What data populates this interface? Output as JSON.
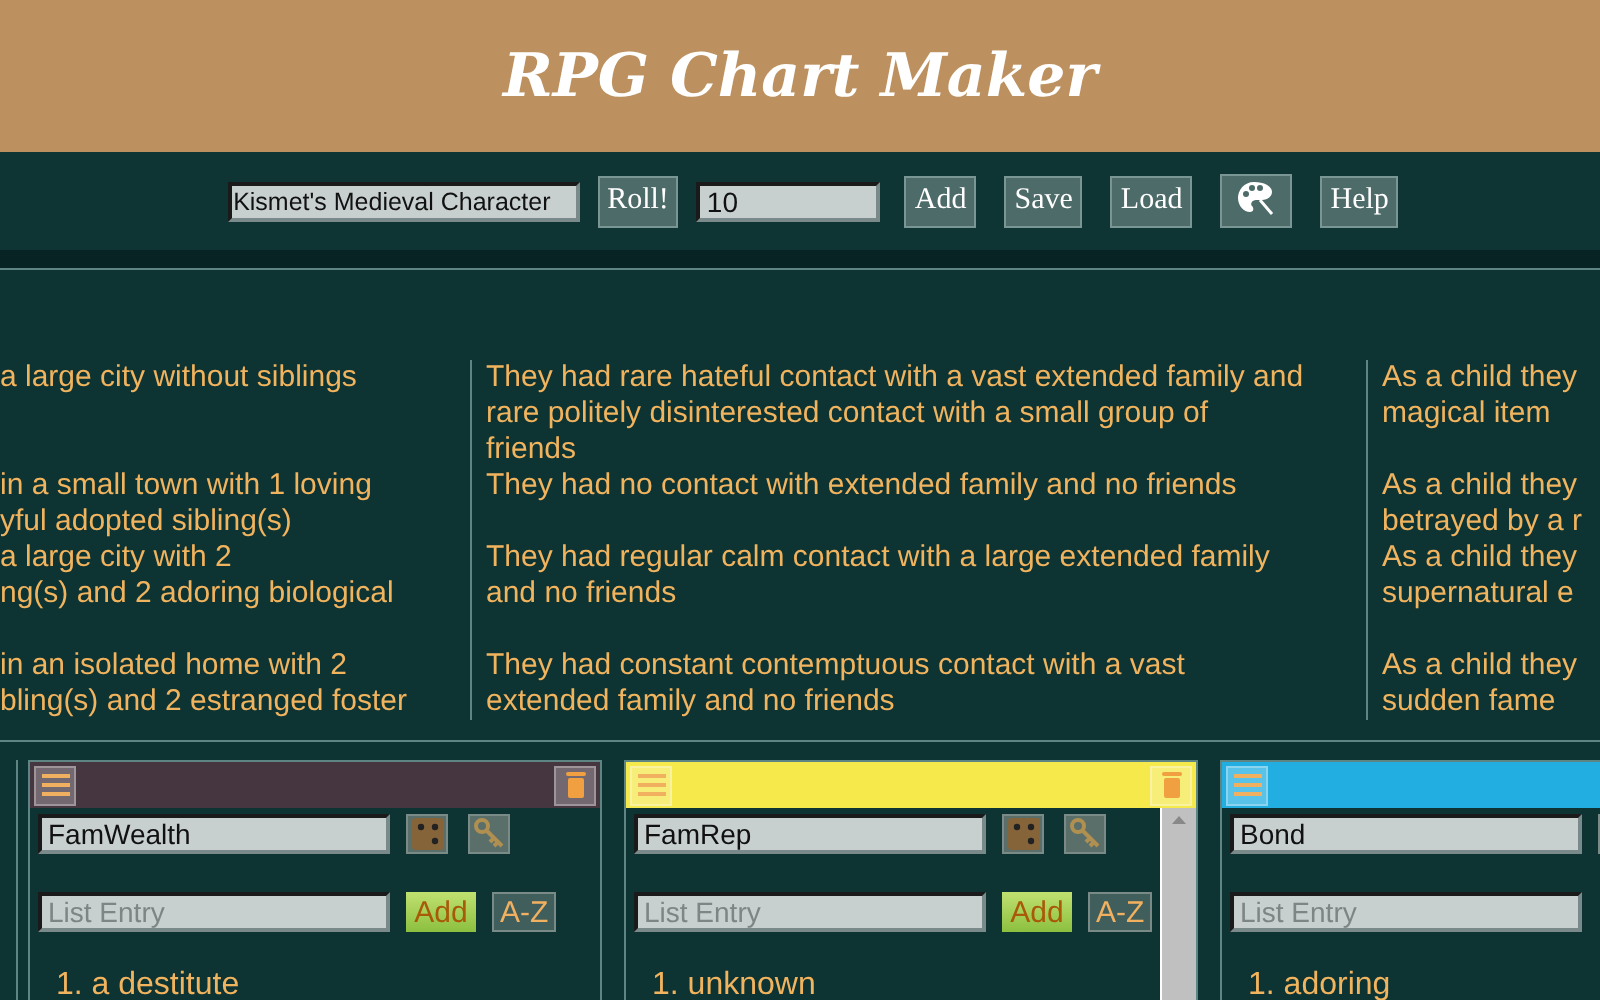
{
  "header": {
    "title": "RPG Chart Maker"
  },
  "toolbar": {
    "chart_name": "Kismet's Medieval Character",
    "roll_button": "Roll!",
    "roll_count": "10",
    "buttons": [
      {
        "kind": "text",
        "label": "Add"
      },
      {
        "kind": "text",
        "label": "Save"
      },
      {
        "kind": "text",
        "label": "Load"
      },
      {
        "kind": "palette"
      },
      {
        "kind": "text",
        "label": "Help"
      }
    ]
  },
  "results": {
    "columns": [
      {
        "cells": [
          [
            "a large city without siblings"
          ],
          [
            "in a small town with 1 loving",
            "yful adopted sibling(s)"
          ],
          [
            "a large city with 2",
            "ng(s) and 2 adoring biological"
          ],
          [
            "in an isolated home with 2",
            "bling(s) and 2 estranged foster"
          ]
        ]
      },
      {
        "cells": [
          [
            "They had rare hateful contact with a vast extended family and",
            "rare politely disinterested contact with a small group of",
            "friends"
          ],
          [
            "They had no contact with extended family and no friends"
          ],
          [
            "They had regular calm contact with a large extended family",
            "and no friends"
          ],
          [
            "They had constant contemptuous contact with a vast",
            "extended family and no friends"
          ]
        ]
      },
      {
        "cells": [
          [
            "As a child they",
            "magical item"
          ],
          [
            "As a child they",
            "betrayed by a r"
          ],
          [
            "As a child they",
            "supernatural e"
          ],
          [
            "As a child they",
            "sudden fame"
          ]
        ]
      }
    ]
  },
  "panels": [
    {
      "color": "#45363f",
      "name": "FamWealth",
      "entry_placeholder": "List Entry",
      "add_button": "Add",
      "sort_button": "A-Z",
      "items": [
        "1. a destitute"
      ],
      "scrollable": false
    },
    {
      "color": "#f5e94c",
      "name": "FamRep",
      "entry_placeholder": "List Entry",
      "add_button": "Add",
      "sort_button": "A-Z",
      "items": [
        "1. unknown"
      ],
      "scrollable": true
    },
    {
      "color": "#22aee0",
      "name": "Bond",
      "entry_placeholder": "List Entry",
      "items": [
        "1. adoring"
      ],
      "scrollable": false
    }
  ]
}
